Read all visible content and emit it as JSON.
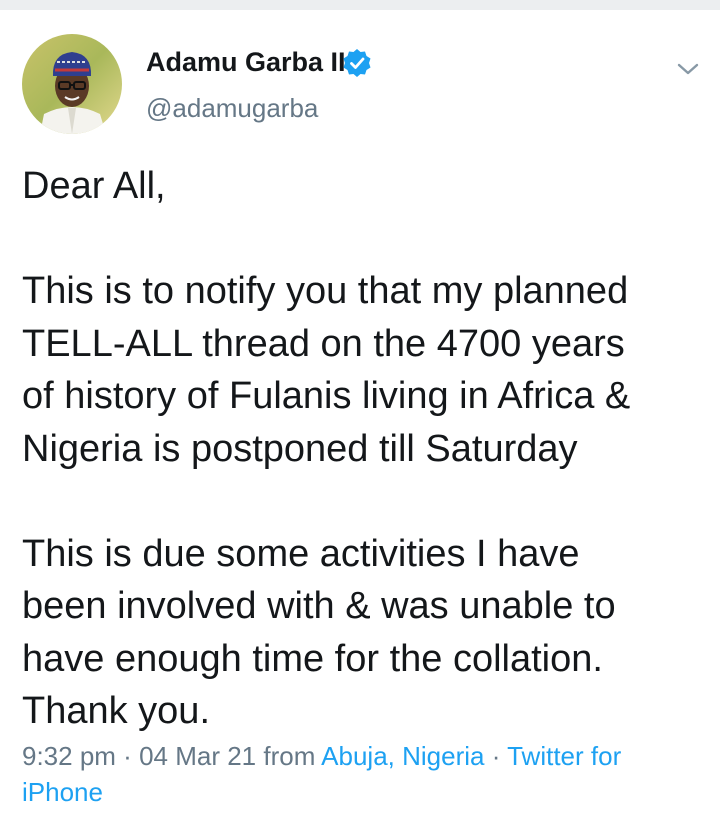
{
  "tweet": {
    "author": {
      "name": "Adamu Garba II",
      "handle": "@adamugarba",
      "verified": true
    },
    "body": {
      "greeting": "Dear All,",
      "paragraph1_lines": [
        "This is to notify you that my planned",
        "TELL-ALL thread on the 4700 years",
        "of history of Fulanis living in Africa &",
        "Nigeria is postponed till Saturday"
      ],
      "paragraph2_lines": [
        "This is due some activities I have",
        "been involved with & was unable to",
        "have enough time for the collation.",
        "Thank you."
      ]
    },
    "meta": {
      "time": "9:32 pm",
      "separator": " · ",
      "date": "04 Mar 21",
      "from_text": " from ",
      "location": "Abuja, Nigeria",
      "source": "Twitter for iPhone"
    }
  },
  "icons": {
    "verified": "verified-badge-icon",
    "menu": "chevron-down-icon"
  },
  "colors": {
    "text_primary": "#14171a",
    "text_secondary": "#657786",
    "link": "#1da1f2",
    "verified": "#1da1f2"
  }
}
